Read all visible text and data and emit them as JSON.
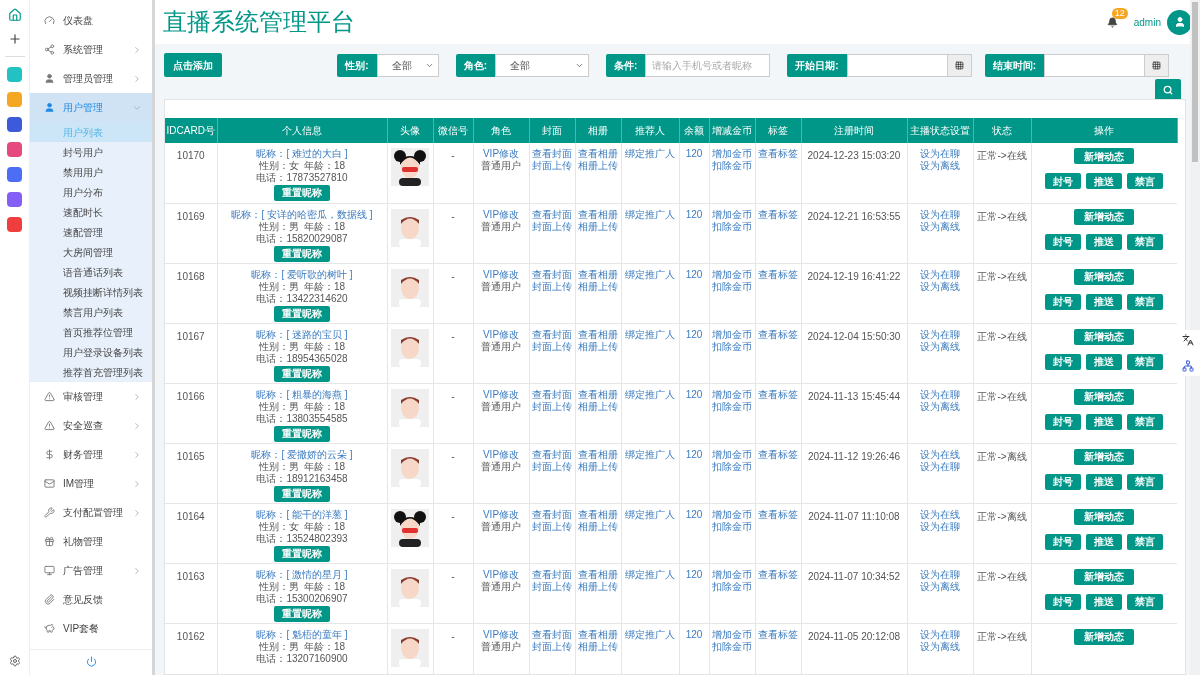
{
  "sidebar": {
    "items": [
      {
        "label": "仪表盘",
        "has_children": false,
        "selected": false
      },
      {
        "label": "系统管理",
        "has_children": true,
        "expanded": false,
        "selected": false
      },
      {
        "label": "管理员管理",
        "has_children": true,
        "expanded": false,
        "selected": false
      },
      {
        "label": "用户管理",
        "has_children": true,
        "expanded": true,
        "selected": true,
        "children": [
          {
            "label": "用户列表",
            "selected": true
          },
          {
            "label": "封号用户",
            "selected": false
          },
          {
            "label": "禁用用户",
            "selected": false
          },
          {
            "label": "用户分布",
            "selected": false
          },
          {
            "label": "速配时长",
            "selected": false
          },
          {
            "label": "速配管理",
            "selected": false
          },
          {
            "label": "大房间管理",
            "selected": false
          },
          {
            "label": "语音通话列表",
            "selected": false
          },
          {
            "label": "视频挂断详情列表",
            "selected": false
          },
          {
            "label": "禁言用户列表",
            "selected": false
          },
          {
            "label": "首页推荐位管理",
            "selected": false
          },
          {
            "label": "用户登录设备列表",
            "selected": false
          },
          {
            "label": "推荐首充管理列表",
            "selected": false
          }
        ]
      },
      {
        "label": "审核管理",
        "has_children": true,
        "expanded": false,
        "selected": false
      },
      {
        "label": "安全巡查",
        "has_children": true,
        "expanded": false,
        "selected": false
      },
      {
        "label": "财务管理",
        "has_children": true,
        "expanded": false,
        "selected": false
      },
      {
        "label": "IM管理",
        "has_children": true,
        "expanded": false,
        "selected": false
      },
      {
        "label": "支付配置管理",
        "has_children": true,
        "expanded": false,
        "selected": false
      },
      {
        "label": "礼物管理",
        "has_children": false,
        "selected": false
      },
      {
        "label": "广告管理",
        "has_children": true,
        "expanded": false,
        "selected": false
      },
      {
        "label": "意见反馈",
        "has_children": false,
        "selected": false
      },
      {
        "label": "VIP套餐",
        "has_children": false,
        "selected": false
      }
    ]
  },
  "header": {
    "title": "直播系统管理平台",
    "notification_count": "12",
    "user": "admin"
  },
  "filters": {
    "add_button": "点击添加",
    "gender": {
      "label": "性别:",
      "value": "全部"
    },
    "role": {
      "label": "角色:",
      "value": "全部"
    },
    "condition": {
      "label": "条件:",
      "placeholder": "请输入手机号或者昵称"
    },
    "start_date": {
      "label": "开始日期:"
    },
    "end_date": {
      "label": "结束时间:"
    }
  },
  "table": {
    "columns": [
      "IDCARD号",
      "个人信息",
      "头像",
      "微信号",
      "角色",
      "封面",
      "相册",
      "推荐人",
      "余额",
      "增减金币",
      "标签",
      "注册时间",
      "主播状态设置",
      "状态",
      "操作"
    ],
    "rows": [
      {
        "id": "10170",
        "nick": "昵称：[ 难过的大白 ]",
        "gender": "性别：女",
        "age": "年龄：18",
        "phone": "电话：17873527810",
        "reset": "重置昵称",
        "avatar": {
          "kind": "female"
        },
        "wechat": "-",
        "role_link": "VIP修改",
        "role": "普通用户",
        "cover": [
          "查看封面",
          "封面上传"
        ],
        "album": [
          "查看相册",
          "相册上传"
        ],
        "referrer": "绑定推广人",
        "balance": "120",
        "coins": [
          "增加金币",
          "扣除金币"
        ],
        "tags": "查看标签",
        "time": "2024-12-23 15:03:20",
        "anchor": [
          "设为在聊",
          "设为离线"
        ],
        "status": "正常->在线",
        "actions": [
          "新增动态",
          "封号",
          "推送",
          "禁言"
        ]
      },
      {
        "id": "10169",
        "nick": "昵称：[ 安详的哈密瓜，数据线 ]",
        "gender": "性别：男",
        "age": "年龄：18",
        "phone": "电话：15820029087",
        "reset": "重置昵称",
        "avatar": {
          "kind": "male"
        },
        "wechat": "-",
        "role_link": "VIP修改",
        "role": "普通用户",
        "cover": [
          "查看封面",
          "封面上传"
        ],
        "album": [
          "查看相册",
          "相册上传"
        ],
        "referrer": "绑定推广人",
        "balance": "120",
        "coins": [
          "增加金币",
          "扣除金币"
        ],
        "tags": "查看标签",
        "time": "2024-12-21 16:53:55",
        "anchor": [
          "设为在聊",
          "设为离线"
        ],
        "status": "正常->在线",
        "actions": [
          "新增动态",
          "封号",
          "推送",
          "禁言"
        ]
      },
      {
        "id": "10168",
        "nick": "昵称：[ 爱听歌的树叶 ]",
        "gender": "性别：男",
        "age": "年龄：18",
        "phone": "电话：13422314620",
        "reset": "重置昵称",
        "avatar": {
          "kind": "male"
        },
        "wechat": "-",
        "role_link": "VIP修改",
        "role": "普通用户",
        "cover": [
          "查看封面",
          "封面上传"
        ],
        "album": [
          "查看相册",
          "相册上传"
        ],
        "referrer": "绑定推广人",
        "balance": "120",
        "coins": [
          "增加金币",
          "扣除金币"
        ],
        "tags": "查看标签",
        "time": "2024-12-19 16:41:22",
        "anchor": [
          "设为在聊",
          "设为离线"
        ],
        "status": "正常->在线",
        "actions": [
          "新增动态",
          "封号",
          "推送",
          "禁言"
        ]
      },
      {
        "id": "10167",
        "nick": "昵称：[ 迷路的宝贝 ]",
        "gender": "性别：男",
        "age": "年龄：18",
        "phone": "电话：18954365028",
        "reset": "重置昵称",
        "avatar": {
          "kind": "male"
        },
        "wechat": "-",
        "role_link": "VIP修改",
        "role": "普通用户",
        "cover": [
          "查看封面",
          "封面上传"
        ],
        "album": [
          "查看相册",
          "相册上传"
        ],
        "referrer": "绑定推广人",
        "balance": "120",
        "coins": [
          "增加金币",
          "扣除金币"
        ],
        "tags": "查看标签",
        "time": "2024-12-04 15:50:30",
        "anchor": [
          "设为在聊",
          "设为离线"
        ],
        "status": "正常->在线",
        "actions": [
          "新增动态",
          "封号",
          "推送",
          "禁言"
        ]
      },
      {
        "id": "10166",
        "nick": "昵称：[ 粗暴的海燕 ]",
        "gender": "性别：男",
        "age": "年龄：18",
        "phone": "电话：13803554585",
        "reset": "重置昵称",
        "avatar": {
          "kind": "male"
        },
        "wechat": "-",
        "role_link": "VIP修改",
        "role": "普通用户",
        "cover": [
          "查看封面",
          "封面上传"
        ],
        "album": [
          "查看相册",
          "相册上传"
        ],
        "referrer": "绑定推广人",
        "balance": "120",
        "coins": [
          "增加金币",
          "扣除金币"
        ],
        "tags": "查看标签",
        "time": "2024-11-13 15:45:44",
        "anchor": [
          "设为在聊",
          "设为离线"
        ],
        "status": "正常->在线",
        "actions": [
          "新增动态",
          "封号",
          "推送",
          "禁言"
        ]
      },
      {
        "id": "10165",
        "nick": "昵称：[ 爱撒娇的云朵 ]",
        "gender": "性别：男",
        "age": "年龄：18",
        "phone": "电话：18912163458",
        "reset": "重置昵称",
        "avatar": {
          "kind": "male"
        },
        "wechat": "-",
        "role_link": "VIP修改",
        "role": "普通用户",
        "cover": [
          "查看封面",
          "封面上传"
        ],
        "album": [
          "查看相册",
          "相册上传"
        ],
        "referrer": "绑定推广人",
        "balance": "120",
        "coins": [
          "增加金币",
          "扣除金币"
        ],
        "tags": "查看标签",
        "time": "2024-11-12 19:26:46",
        "anchor": [
          "设为在线",
          "设为在聊"
        ],
        "status": "正常->离线",
        "actions": [
          "新增动态",
          "封号",
          "推送",
          "禁言"
        ]
      },
      {
        "id": "10164",
        "nick": "昵称：[ 能干的洋葱 ]",
        "gender": "性别：女",
        "age": "年龄：18",
        "phone": "电话：13524802393",
        "reset": "重置昵称",
        "avatar": {
          "kind": "female"
        },
        "wechat": "-",
        "role_link": "VIP修改",
        "role": "普通用户",
        "cover": [
          "查看封面",
          "封面上传"
        ],
        "album": [
          "查看相册",
          "相册上传"
        ],
        "referrer": "绑定推广人",
        "balance": "120",
        "coins": [
          "增加金币",
          "扣除金币"
        ],
        "tags": "查看标签",
        "time": "2024-11-07 11:10:08",
        "anchor": [
          "设为在线",
          "设为在聊"
        ],
        "status": "正常->离线",
        "actions": [
          "新增动态",
          "封号",
          "推送",
          "禁言"
        ]
      },
      {
        "id": "10163",
        "nick": "昵称：[ 激情的星月 ]",
        "gender": "性别：男",
        "age": "年龄：18",
        "phone": "电话：15300206907",
        "reset": "重置昵称",
        "avatar": {
          "kind": "male"
        },
        "wechat": "-",
        "role_link": "VIP修改",
        "role": "普通用户",
        "cover": [
          "查看封面",
          "封面上传"
        ],
        "album": [
          "查看相册",
          "相册上传"
        ],
        "referrer": "绑定推广人",
        "balance": "120",
        "coins": [
          "增加金币",
          "扣除金币"
        ],
        "tags": "查看标签",
        "time": "2024-11-07 10:34:52",
        "anchor": [
          "设为在聊",
          "设为离线"
        ],
        "status": "正常->在线",
        "actions": [
          "新增动态",
          "封号",
          "推送",
          "禁言"
        ]
      },
      {
        "id": "10162",
        "nick": "昵称：[ 魁梧的童年 ]",
        "gender": "性别：男",
        "age": "年龄：18",
        "phone": "电话：13207160900",
        "avatar": {
          "kind": "male"
        },
        "wechat": "-",
        "role_link": "VIP修改",
        "role": "普通用户",
        "cover": [
          "查看封面",
          "封面上传"
        ],
        "album": [
          "查看相册",
          "相册上传"
        ],
        "referrer": "绑定推广人",
        "balance": "120",
        "coins": [
          "增加金币",
          "扣除金币"
        ],
        "tags": "查看标签",
        "time": "2024-11-05 20:12:08",
        "anchor": [
          "设为在聊",
          "设为离线"
        ],
        "status": "正常->在线",
        "actions": [
          "新增动态"
        ]
      }
    ]
  }
}
